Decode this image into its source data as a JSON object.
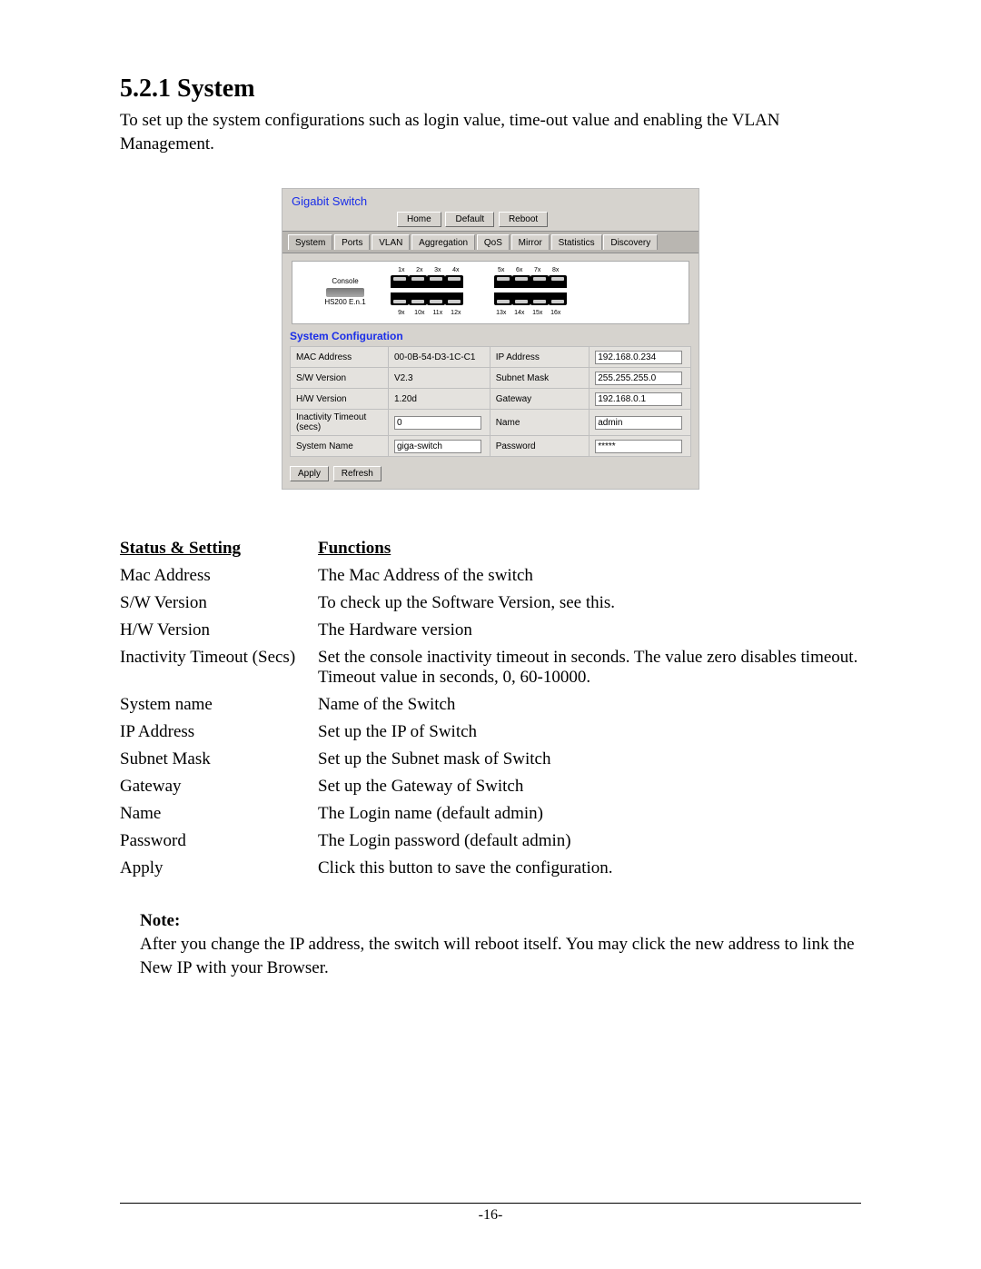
{
  "heading": "5.2.1 System",
  "intro": "To set up the system configurations such as login value, time-out value and enabling the VLAN Management.",
  "screenshot": {
    "title": "Gigabit Switch",
    "top_buttons": {
      "home": "Home",
      "default": "Default",
      "reboot": "Reboot"
    },
    "tabs": {
      "system": "System",
      "ports": "Ports",
      "vlan": "VLAN",
      "aggregation": "Aggregation",
      "qos": "QoS",
      "mirror": "Mirror",
      "statistics": "Statistics",
      "discovery": "Discovery"
    },
    "ports": {
      "console_label": "Console",
      "backbone_label": "HS200 E.n.1",
      "top_left": [
        "1x",
        "2x",
        "3x",
        "4x"
      ],
      "top_right": [
        "5x",
        "6x",
        "7x",
        "8x"
      ],
      "bot_left": [
        "9x",
        "10x",
        "11x",
        "12x"
      ],
      "bot_right": [
        "13x",
        "14x",
        "15x",
        "16x"
      ]
    },
    "section_title": "System Configuration",
    "rows": {
      "mac_l": "MAC Address",
      "mac_v": "00-0B-54-D3-1C-C1",
      "swv_l": "S/W Version",
      "swv_v": "V2.3",
      "hwv_l": "H/W Version",
      "hwv_v": "1.20d",
      "to_l": "Inactivity Timeout (secs)",
      "to_v": "0",
      "sn_l": "System Name",
      "sn_v": "giga-switch",
      "ip_l": "IP Address",
      "ip_v": "192.168.0.234",
      "sm_l": "Subnet Mask",
      "sm_v": "255.255.255.0",
      "gw_l": "Gateway",
      "gw_v": "192.168.0.1",
      "nm_l": "Name",
      "nm_v": "admin",
      "pw_l": "Password",
      "pw_v": "*****"
    },
    "footer_buttons": {
      "apply": "Apply",
      "refresh": "Refresh"
    }
  },
  "table": {
    "h1": "Status & Setting",
    "h2": "Functions",
    "rows": {
      "r1a": "Mac Address",
      "r1b": "The Mac Address of the switch",
      "r2a": "S/W Version",
      "r2b": "To check up the Software Version, see this.",
      "r3a": "H/W Version",
      "r3b": "The Hardware version",
      "r4a": "Inactivity Timeout (Secs)",
      "r4b": "Set the console inactivity timeout in seconds. The value zero disables timeout. Timeout value in seconds, 0, 60-10000.",
      "r5a": "System name",
      "r5b": "Name of the Switch",
      "r6a": "IP Address",
      "r6b": "Set up the IP of Switch",
      "r7a": "Subnet Mask",
      "r7b": "Set up the Subnet mask of Switch",
      "r8a": "Gateway",
      "r8b": "Set up the Gateway of Switch",
      "r9a": "Name",
      "r9b": "The Login name (default admin)",
      "r10a": "Password",
      "r10b": "The Login password (default admin)",
      "r11a": "Apply",
      "r11b": "Click this button to save the configuration."
    }
  },
  "note": {
    "label": "Note:",
    "body": "After you change the IP address, the switch will reboot itself. You may click the new address to link the New IP with your Browser."
  },
  "page_number": "-16-"
}
